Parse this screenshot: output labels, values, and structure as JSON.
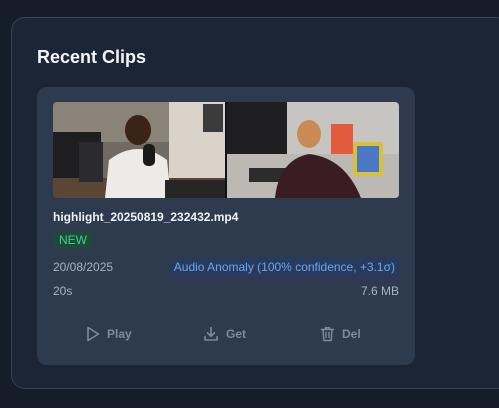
{
  "section": {
    "title": "Recent Clips"
  },
  "clip": {
    "filename": "highlight_20250819_232432.mp4",
    "badge": "NEW",
    "date": "20/08/2025",
    "anomaly": "Audio Anomaly (100% confidence, +3.1σ)",
    "duration": "20s",
    "size": "7.6 MB",
    "actions": {
      "play": "Play",
      "get": "Get",
      "del": "Del"
    }
  },
  "colors": {
    "background": "#151d2b",
    "panel": "#1b2536",
    "card": "#2e3b4e",
    "new_badge_text": "#3fd18e",
    "anomaly_text": "#6aa4f2",
    "muted_text": "#a9b3c1"
  },
  "icons": {
    "play": "play-icon",
    "get": "download-icon",
    "del": "trash-icon"
  }
}
